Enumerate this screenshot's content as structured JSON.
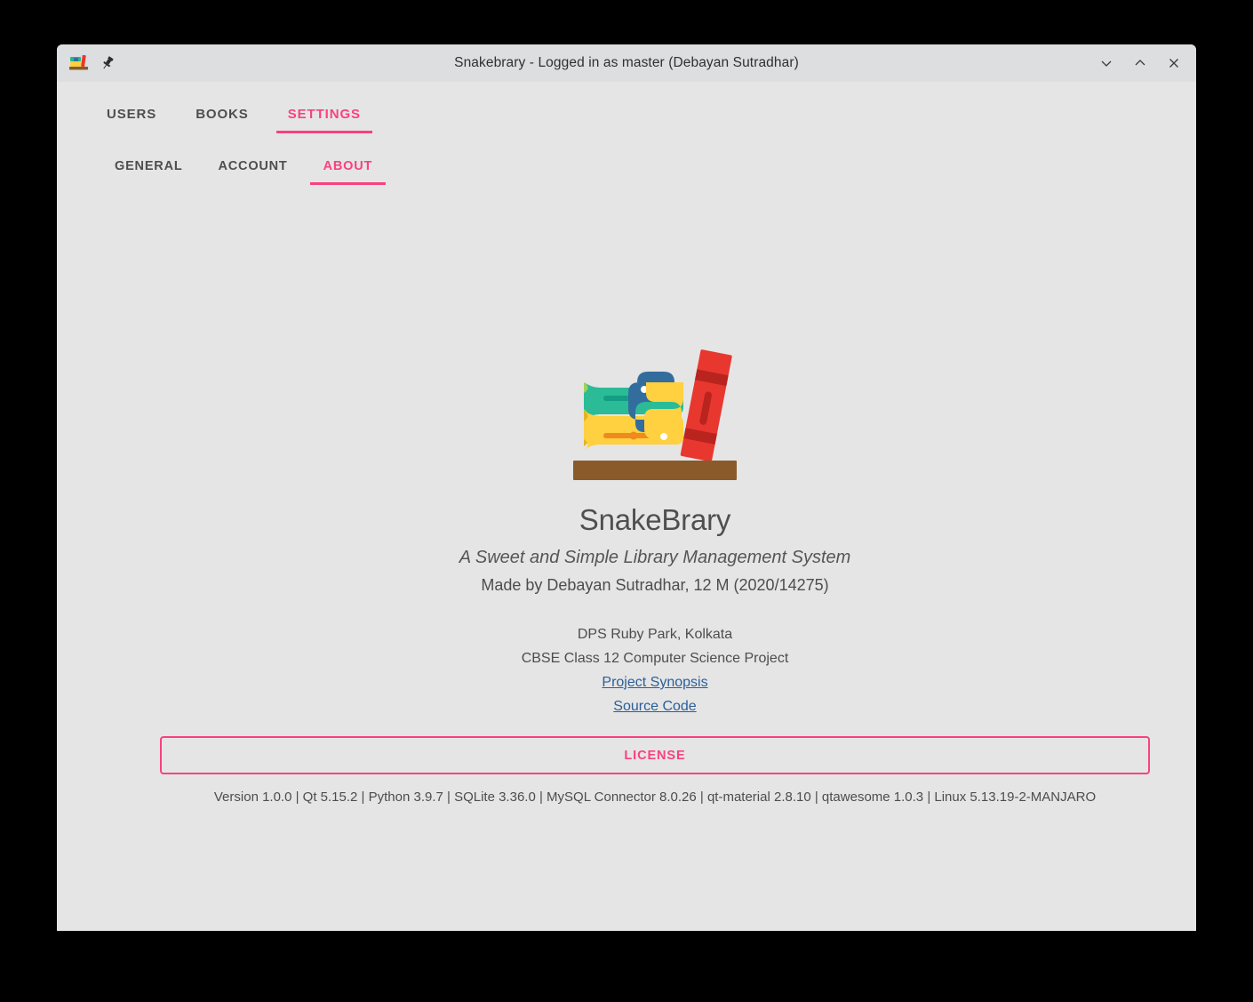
{
  "window": {
    "title": "Snakebrary - Logged in as master (Debayan Sutradhar)",
    "app_icon": "books-logo-icon",
    "pin_icon": "pin-icon",
    "controls": [
      {
        "name": "minimize-button",
        "glyph": "⌄"
      },
      {
        "name": "maximize-button",
        "glyph": "⌃"
      },
      {
        "name": "close-button",
        "glyph": "✕"
      }
    ]
  },
  "main_tabs": [
    {
      "label": "USERS",
      "active": false
    },
    {
      "label": "BOOKS",
      "active": false
    },
    {
      "label": "SETTINGS",
      "active": true
    }
  ],
  "sub_tabs": [
    {
      "label": "GENERAL",
      "active": false
    },
    {
      "label": "ACCOUNT",
      "active": false
    },
    {
      "label": "ABOUT",
      "active": true
    }
  ],
  "about": {
    "logo_icon": "snakebrary-books-python-logo",
    "app_name": "SnakeBrary",
    "tagline": "A Sweet and Simple Library Management System",
    "author": "Made by Debayan Sutradhar, 12 M (2020/14275)",
    "school": "DPS Ruby Park, Kolkata",
    "project": "CBSE Class 12 Computer Science Project",
    "links": [
      {
        "label": "Project Synopsis"
      },
      {
        "label": "Source Code"
      }
    ],
    "license_button": "LICENSE",
    "versions": "Version 1.0.0  |  Qt 5.15.2  |  Python 3.9.7  |  SQLite 3.36.0  |  MySQL Connector 8.0.26  |  qt-material 2.8.10  |  qtawesome 1.0.3  |  Linux 5.13.19-2-MANJARO"
  },
  "colors": {
    "accent_pink": "#f8427f",
    "link_blue": "#2a6099",
    "content_bg": "#e5e5e5",
    "titlebar_bg": "#dcdee0",
    "text_gray": "#4d4d4d",
    "book_green": "#21b793",
    "book_yellow": "#ffd040",
    "book_red": "#e8372f",
    "shelf_brown": "#8a5a2b",
    "python_blue": "#336d9e"
  }
}
